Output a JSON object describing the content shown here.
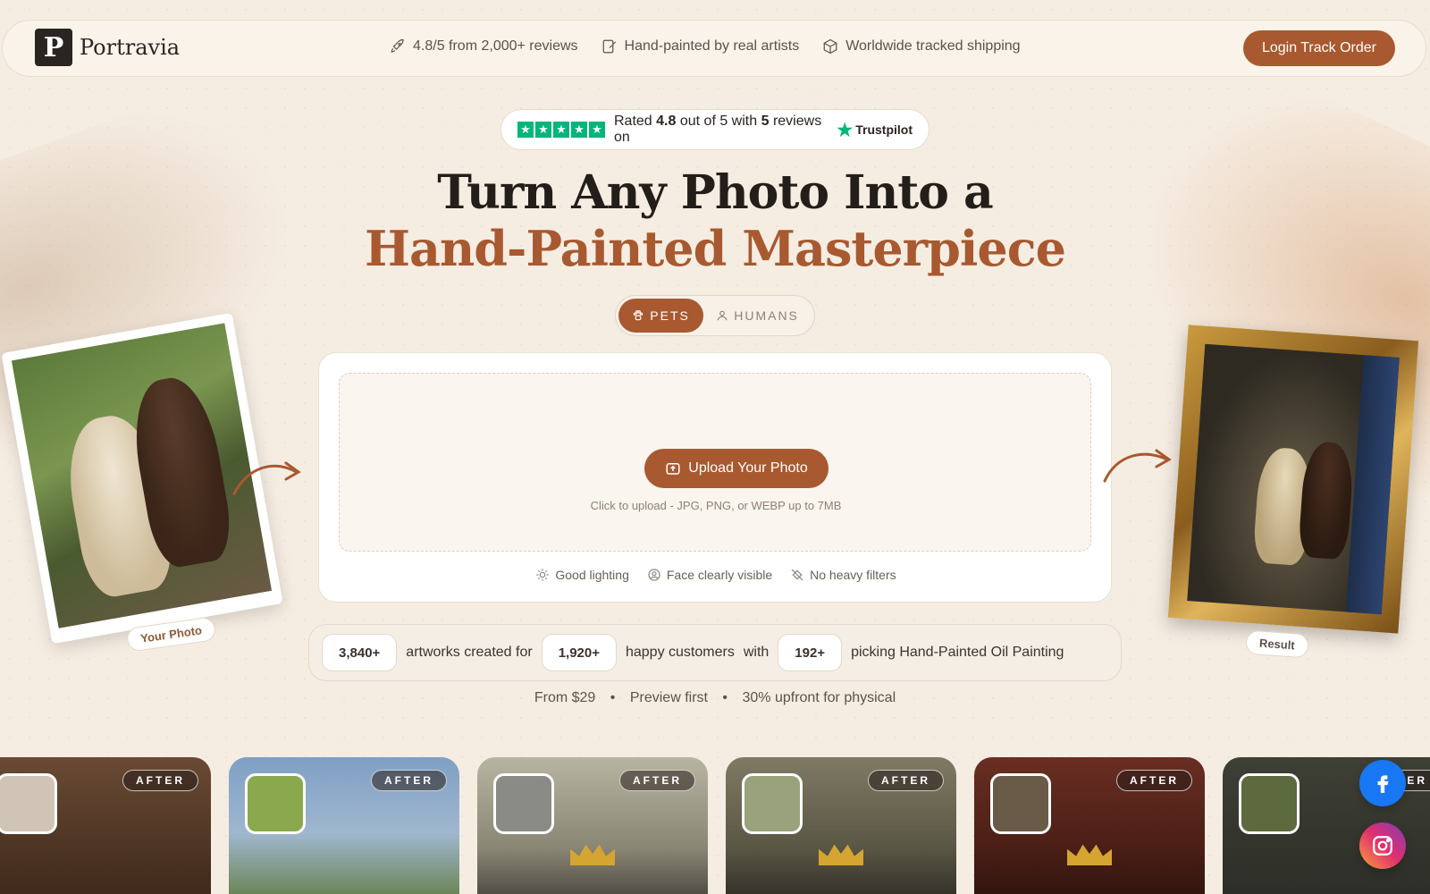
{
  "brand": {
    "name": "Portravia",
    "logo_letter": "P"
  },
  "header": {
    "features": [
      {
        "icon": "rocket-icon",
        "label": "4.8/5 from 2,000+ reviews"
      },
      {
        "icon": "brush-icon",
        "label": "Hand-painted by real artists"
      },
      {
        "icon": "box-icon",
        "label": "Worldwide tracked shipping"
      }
    ],
    "login_label": "Login Track Order"
  },
  "trustpilot": {
    "prefix": "Rated",
    "rating": "4.8",
    "mid": "out of 5 with",
    "count": "5",
    "suffix": "reviews on",
    "brand": "Trustpilot"
  },
  "hero": {
    "line1": "Turn Any Photo Into a",
    "line2": "Hand-Painted Masterpiece"
  },
  "toggle": {
    "options": [
      {
        "label": "PETS",
        "icon": "paw-icon",
        "active": true
      },
      {
        "label": "HUMANS",
        "icon": "user-icon",
        "active": false
      }
    ]
  },
  "upload": {
    "button_label": "Upload Your Photo",
    "hint": "Click to upload - JPG, PNG, or WEBP up to 7MB",
    "tips": [
      {
        "icon": "sun-icon",
        "label": "Good lighting"
      },
      {
        "icon": "face-icon",
        "label": "Face clearly visible"
      },
      {
        "icon": "no-filter-icon",
        "label": "No heavy filters"
      }
    ]
  },
  "stats": {
    "artworks": "3,840+",
    "text1": "artworks created for",
    "customers": "1,920+",
    "text2": "happy customers",
    "text3": "with",
    "oil": "192+",
    "text4": "picking Hand-Painted Oil Painting"
  },
  "subline": {
    "items": [
      "From $29",
      "Preview first",
      "30% upfront for physical"
    ],
    "separator": "•"
  },
  "labels": {
    "your_photo": "Your Photo",
    "result": "Result"
  },
  "gallery": {
    "after_label": "AFTER",
    "cards": [
      {
        "bg": "#4a3526",
        "thumb": "#cfc4b6"
      },
      {
        "bg": "#7fa0c4",
        "thumb": "#8aa84e"
      },
      {
        "bg": "#a8a494",
        "thumb": "#8a8a86"
      },
      {
        "bg": "#6e6a54",
        "thumb": "#9aa27c"
      },
      {
        "bg": "#5a2a20",
        "thumb": "#6a5a48"
      },
      {
        "bg": "#3a3a36",
        "thumb": "#5c6a3e"
      }
    ]
  },
  "colors": {
    "accent": "#a8592f",
    "background": "#f6ede2",
    "trustpilot_green": "#00b67a",
    "facebook": "#1877f2"
  },
  "social": {
    "facebook_icon": "facebook-icon",
    "instagram_icon": "instagram-icon"
  }
}
